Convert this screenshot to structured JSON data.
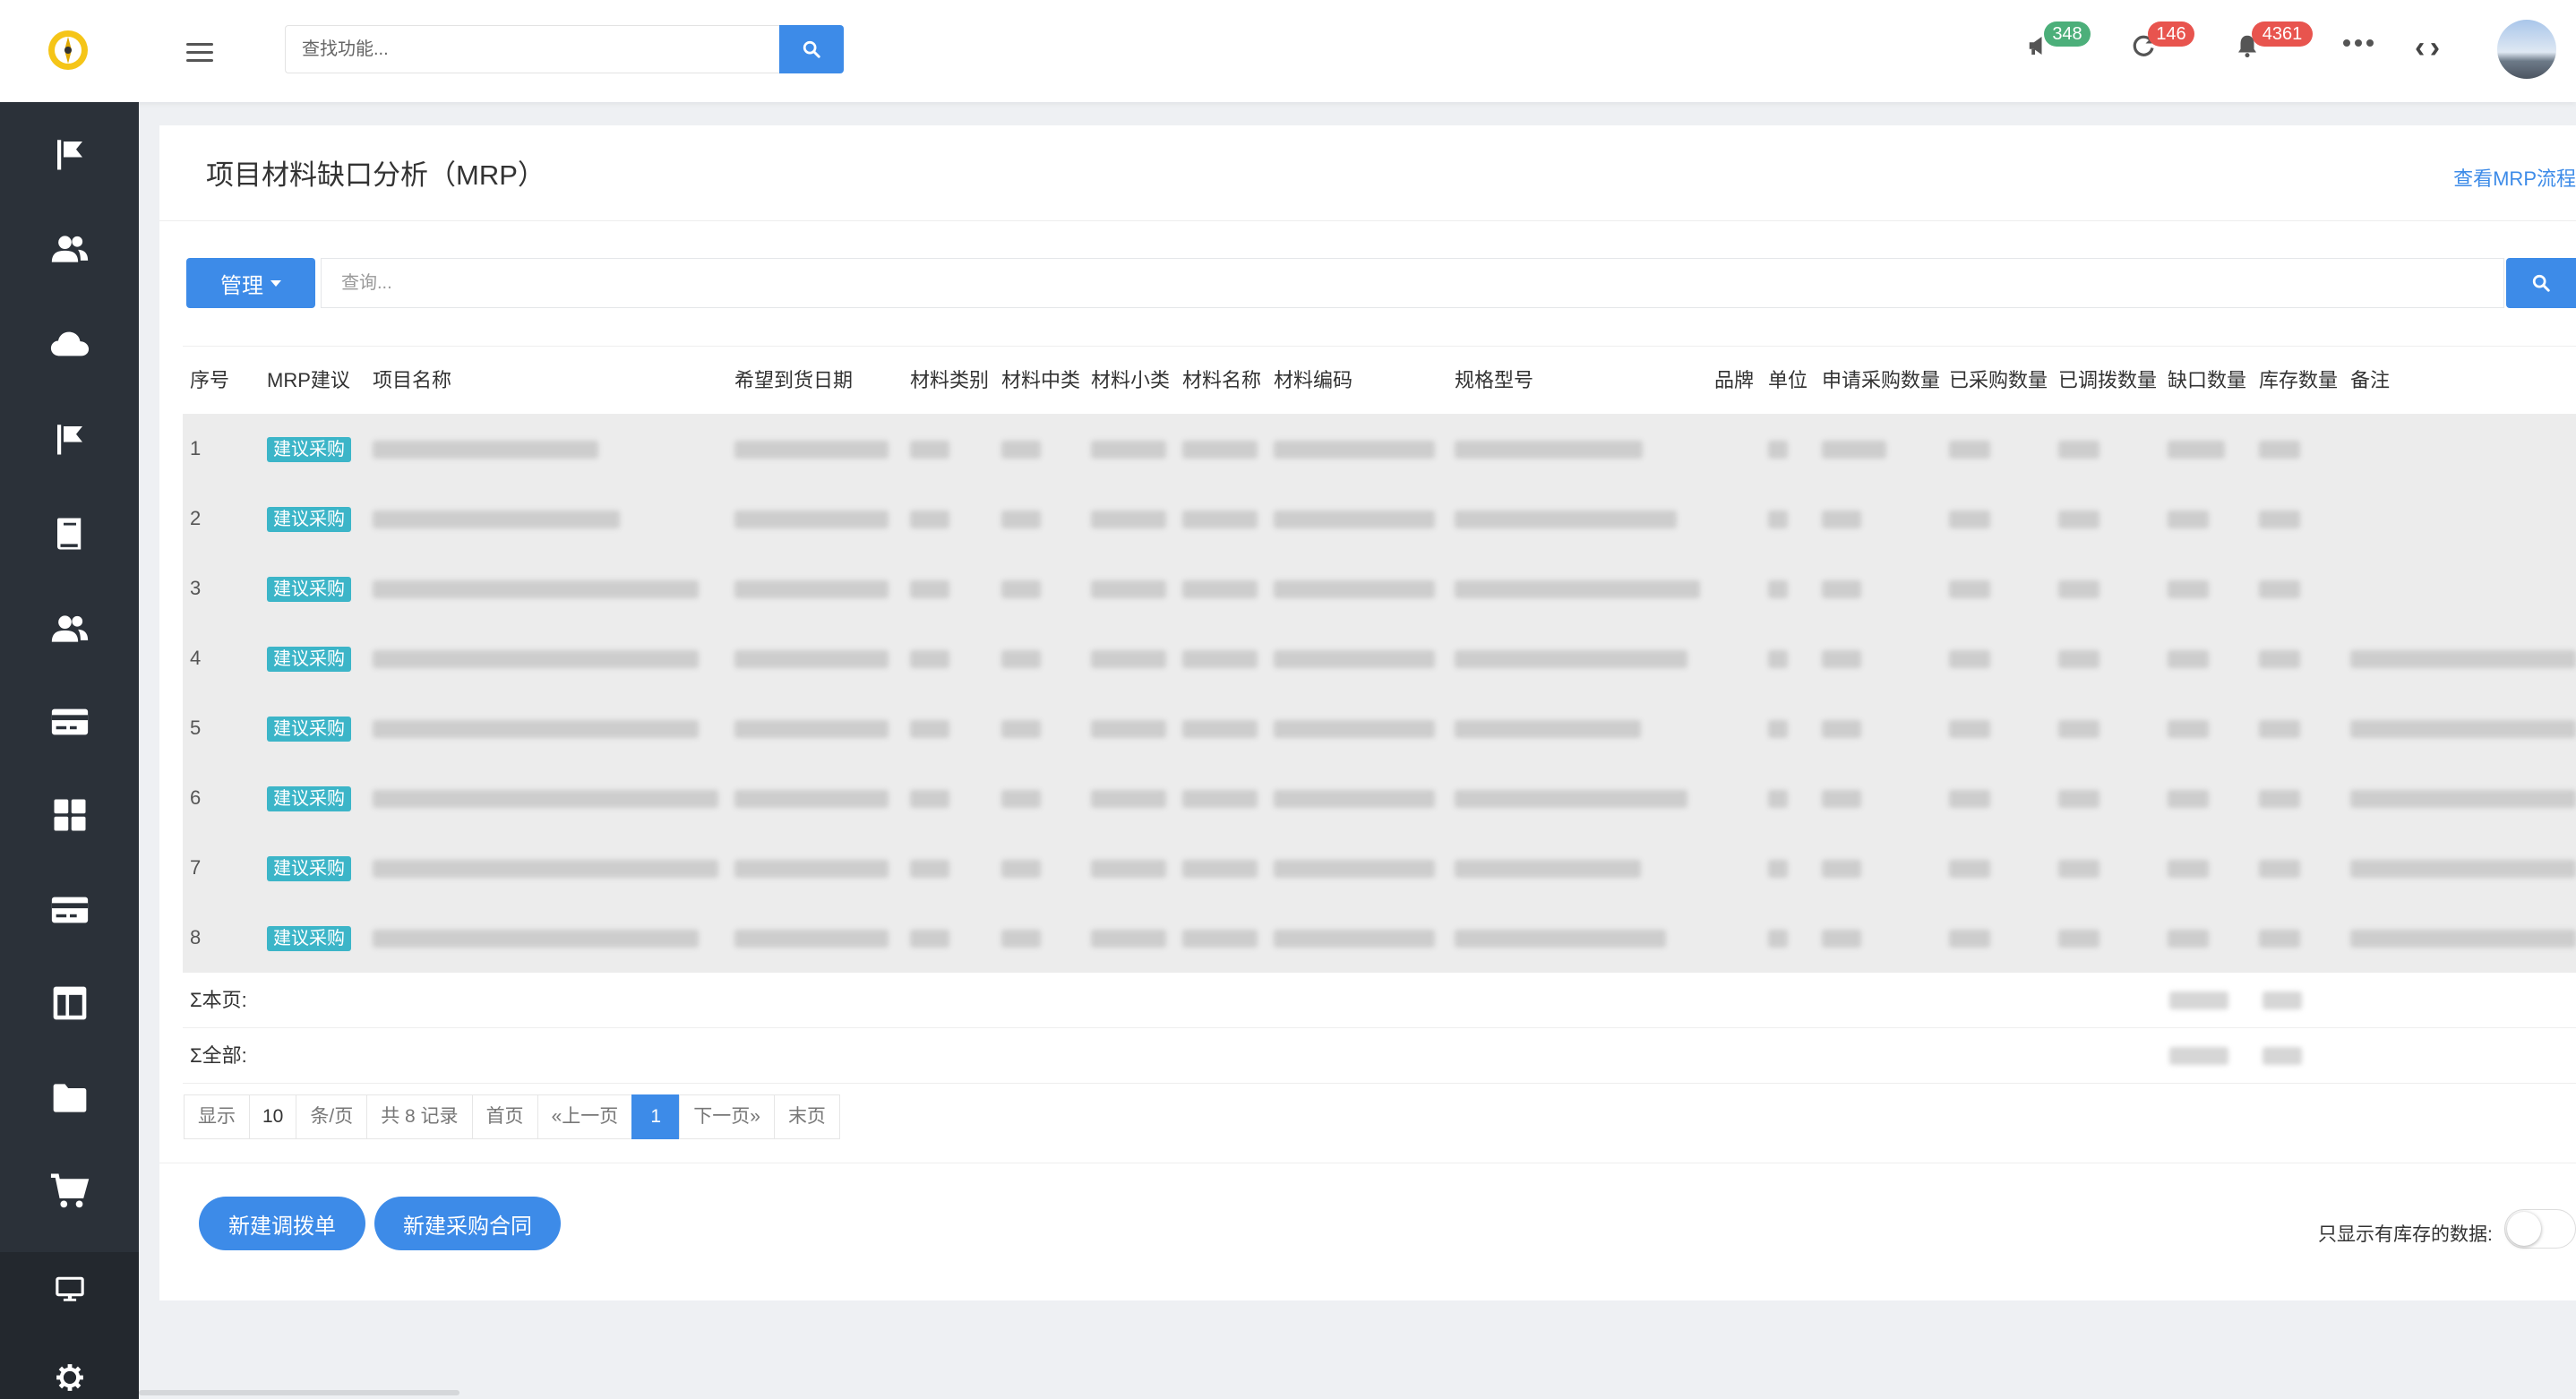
{
  "header": {
    "search_placeholder": "查找功能...",
    "icons": [
      "logo",
      "menu-icon",
      "search-icon",
      "megaphone-icon",
      "refresh-icon",
      "bell-icon",
      "more-icon",
      "code-icon",
      "avatar"
    ],
    "badges": {
      "announcements": "348",
      "sync": "146",
      "alerts": "4361"
    },
    "badge_colors": {
      "announcements": "#4caf7a",
      "sync": "#e8544e",
      "alerts": "#e8544e"
    }
  },
  "sidebar": {
    "icons": [
      "flag-icon",
      "users-icon",
      "cloud-icon",
      "flag-icon",
      "book-icon",
      "users-icon",
      "card-icon",
      "dashboard-icon",
      "card-icon",
      "layout-icon",
      "folder-icon",
      "cart-icon",
      "monitor-icon",
      "gear-icon"
    ]
  },
  "page": {
    "title": "项目材料缺口分析（MRP）",
    "mrp_link": "查看MRP流程",
    "manage_label": "管理",
    "query_placeholder": "查询..."
  },
  "table": {
    "columns": [
      "序号",
      "MRP建议",
      "项目名称",
      "希望到货日期",
      "材料类别",
      "材料中类",
      "材料小类",
      "材料名称",
      "材料编码",
      "规格型号",
      "品牌",
      "单位",
      "申请采购数量",
      "已采购数量",
      "已调拨数量",
      "缺口数量",
      "库存数量",
      "备注"
    ],
    "rows": [
      {
        "index": "1",
        "suggestion": "建议采购"
      },
      {
        "index": "2",
        "suggestion": "建议采购"
      },
      {
        "index": "3",
        "suggestion": "建议采购"
      },
      {
        "index": "4",
        "suggestion": "建议采购"
      },
      {
        "index": "5",
        "suggestion": "建议采购"
      },
      {
        "index": "6",
        "suggestion": "建议采购"
      },
      {
        "index": "7",
        "suggestion": "建议采购"
      },
      {
        "index": "8",
        "suggestion": "建议采购"
      }
    ],
    "sum_page": "Σ本页:",
    "sum_all": "Σ全部:"
  },
  "pagination": {
    "show": "显示",
    "page_size": "10",
    "per_page": "条/页",
    "total": "共 8 记录",
    "first": "首页",
    "prev": "«上一页",
    "current": "1",
    "next": "下一页»",
    "last": "末页"
  },
  "actions": {
    "new_transfer": "新建调拨单",
    "new_purchase": "新建采购合同",
    "stock_only_label": "只显示有库存的数据:",
    "stock_only_value": "否"
  },
  "colors": {
    "primary": "#3d8be8",
    "tag": "#3cb5c8",
    "sidebar": "#2b3139"
  }
}
